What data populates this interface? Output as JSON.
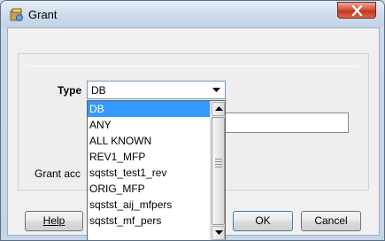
{
  "window": {
    "title": "Grant",
    "close_icon": "close-icon",
    "app_icon": "app-icon"
  },
  "form": {
    "type_label": "Type",
    "type_selected": "DB",
    "grant_label": "Grant acc",
    "text_value": ""
  },
  "dropdown": {
    "options": [
      "DB",
      "ANY",
      "ALL KNOWN",
      "REV1_MFP",
      "sqstst_test1_rev",
      "ORIG_MFP",
      "sqstst_aij_mfpers",
      "sqstst_mf_pers"
    ],
    "highlighted": "DB"
  },
  "buttons": {
    "help": "Help",
    "ok": "OK",
    "cancel": "Cancel"
  },
  "colors": {
    "selection": "#3399ff",
    "close_button": "#c1371f"
  }
}
